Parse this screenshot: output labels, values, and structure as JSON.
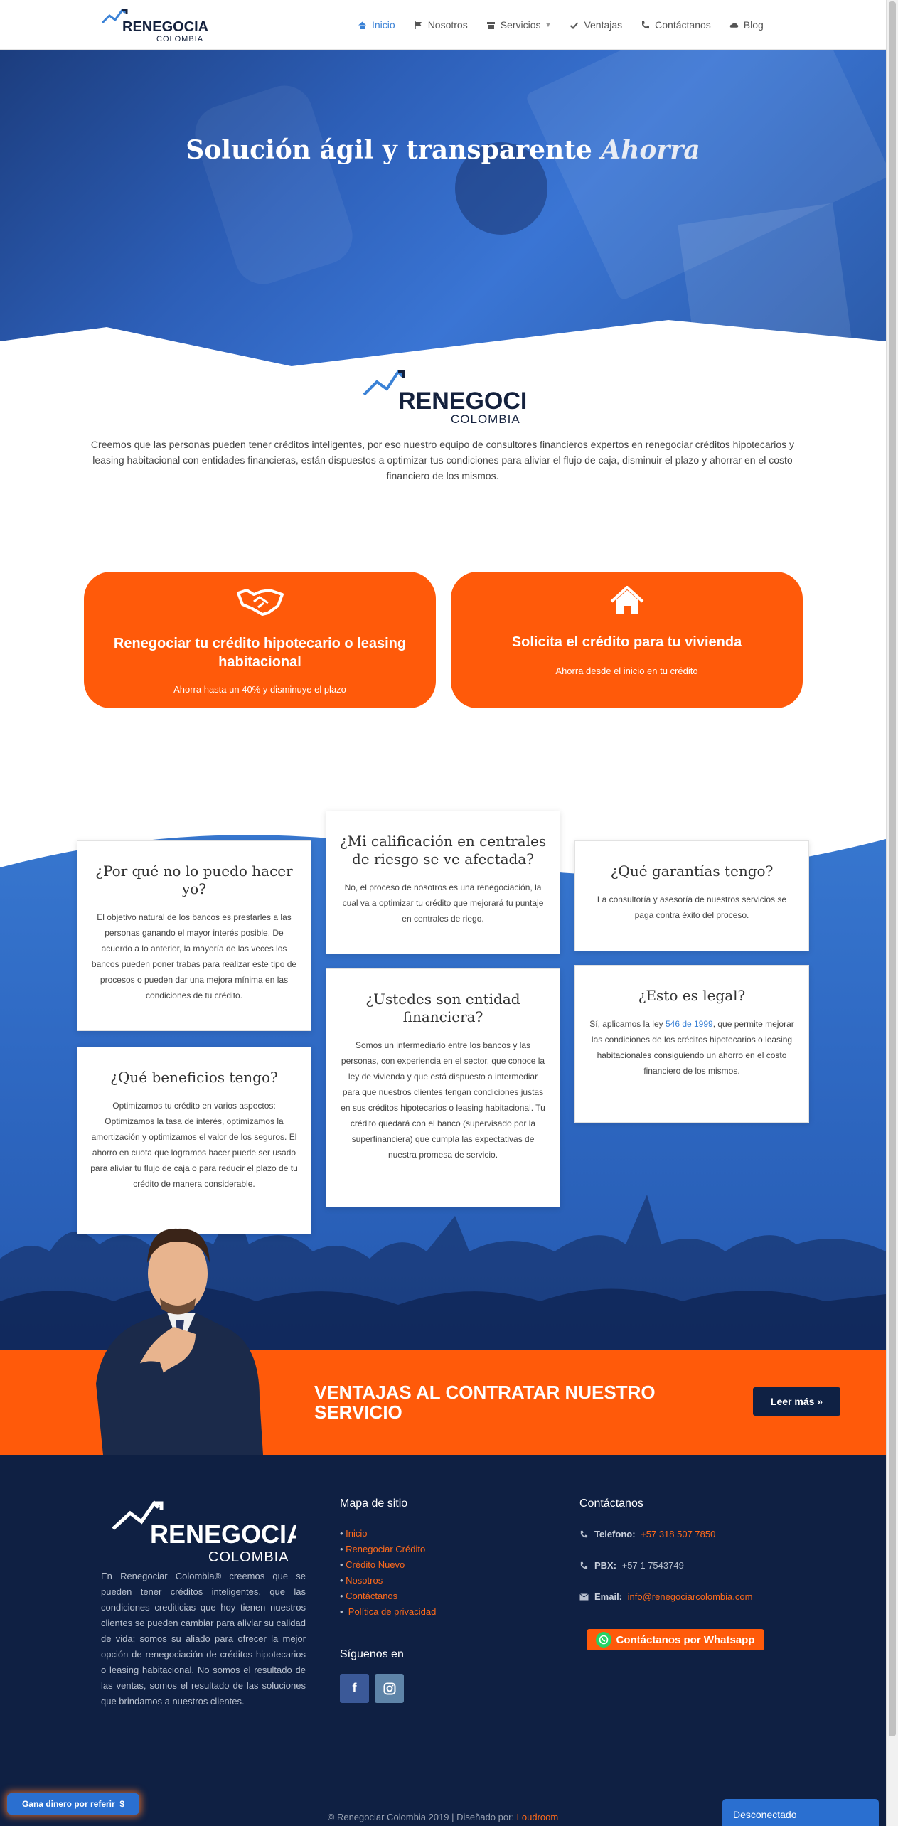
{
  "nav": {
    "items": [
      {
        "label": "Inicio",
        "icon": "home-icon"
      },
      {
        "label": "Nosotros",
        "icon": "flag-icon"
      },
      {
        "label": "Servicios",
        "icon": "archive-icon"
      },
      {
        "label": "Ventajas",
        "icon": "check-icon"
      },
      {
        "label": "Contáctanos",
        "icon": "phone-icon"
      },
      {
        "label": "Blog",
        "icon": "cloud-icon"
      }
    ]
  },
  "brand": {
    "name": "RENEGOCIAR",
    "sub": "COLOMBIA",
    "navy": "#14213d",
    "blue": "#3b82d6",
    "orange": "#ff5a0a"
  },
  "hero": {
    "title": "Solución ágil y transparente",
    "title_em": "Ahorra"
  },
  "intro": {
    "text": "Creemos que las personas pueden tener créditos inteligentes, por eso nuestro equipo de  consultores financieros expertos en renegociar créditos hipotecarios y leasing habitacional con entidades financieras, están dispuestos a optimizar tus condiciones para aliviar el flujo de caja, disminuir el plazo y ahorrar en el costo financiero de los mismos."
  },
  "services": [
    {
      "title": "Renegociar tu crédito hipotecario o leasing habitacional",
      "sub": "Ahorra hasta un 40% y disminuye el plazo",
      "icon": "handshake-icon"
    },
    {
      "title": "Solicita el crédito para tu vivienda",
      "sub": "Ahorra desde el inicio en tu crédito",
      "icon": "house-icon"
    }
  ],
  "faq": {
    "q1": {
      "title": "¿Por qué no lo puedo hacer yo?",
      "text": "El objetivo natural de los bancos es prestarles a las personas ganando el mayor interés posible. De acuerdo a lo anterior, la mayoría de las veces los bancos pueden poner trabas para realizar este tipo de procesos o pueden dar una mejora mínima en las condiciones de tu crédito."
    },
    "q2": {
      "title": "¿Qué beneficios tengo?",
      "text": "Optimizamos tu crédito en varios aspectos: Optimizamos la tasa de interés, optimizamos la amortización y optimizamos el valor de los seguros. El ahorro en cuota que logramos hacer puede ser usado para aliviar tu flujo de caja o para reducir el plazo de tu crédito de manera considerable."
    },
    "q3": {
      "title": "¿Mi calificación en centrales de riesgo se ve afectada?",
      "text": "No, el proceso de nosotros es una renegociación, la cual va a optimizar tu crédito que mejorará tu puntaje en centrales de riego."
    },
    "q4": {
      "title": "¿Ustedes son entidad financiera?",
      "text": "Somos un intermediario entre los bancos y las personas, con experiencia en el sector, que conoce la ley de vivienda y que está dispuesto a intermediar para que nuestros clientes tengan condiciones justas en sus créditos hipotecarios o leasing habitacional. Tu crédito quedará con el banco (supervisado por la superfinanciera) que cumpla las expectativas de nuestra promesa de servicio."
    },
    "q5": {
      "title": "¿Qué garantías tengo?",
      "text": "La consultoría y asesoría de nuestros servicios se paga contra éxito del proceso."
    },
    "q6": {
      "title": "¿Esto es legal?",
      "text_pre": "Sí, aplicamos la ley ",
      "link": "546 de 1999",
      "text_post": ", que permite mejorar las condiciones de los créditos hipotecarios o leasing habitacionales consiguiendo un ahorro en el costo financiero de los mismos."
    }
  },
  "cta": {
    "title": "VENTAJAS AL CONTRATAR NUESTRO SERVICIO",
    "button": "Leer más"
  },
  "footer": {
    "about": "En Renegociar Colombia® creemos que se pueden tener créditos inteligentes, que las condiciones crediticias que hoy tienen nuestros clientes se pueden cambiar para aliviar su calidad de vida; somos su aliado para ofrecer la mejor opción de renegociación de créditos hipotecarios o leasing habitacional. No somos el resultado de las ventas, somos el resultado de las soluciones que brindamos a nuestros clientes.",
    "sitemap_title": "Mapa de sitio",
    "sitemap": [
      "Inicio",
      "Renegociar Crédito",
      "Crédito Nuevo",
      "Nosotros",
      "Contáctanos",
      "Política de privacidad"
    ],
    "follow_title": "Síguenos en",
    "contact_title": "Contáctanos",
    "phone_label": "Telefono:",
    "phone": "+57 318 507 7850",
    "pbx_label": "PBX:",
    "pbx": "+57 1 7543749",
    "email_label": "Email:",
    "email": "info@renegociarcolombia.com",
    "whatsapp": "Contáctanos por Whatsapp",
    "copyright": "© Renegociar Colombia 2019 | Diseñado por:",
    "designer": "Loudroom"
  },
  "widgets": {
    "refer": "Gana dinero por referir",
    "chat": "Desconectado"
  }
}
